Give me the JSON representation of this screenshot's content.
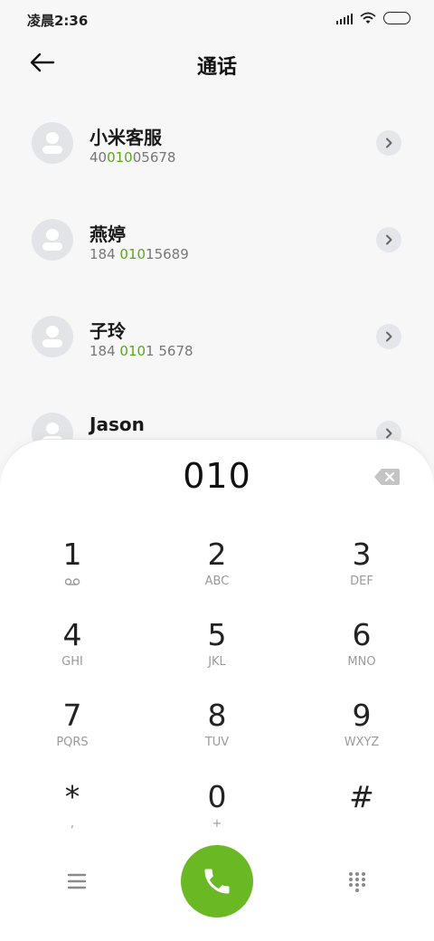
{
  "status_bar": {
    "time": "凌晨2:36",
    "icons": [
      "signal-icon",
      "wifi-icon",
      "battery-icon"
    ]
  },
  "header": {
    "title": "通话",
    "back_icon": "back-arrow-icon"
  },
  "contacts": [
    {
      "name": "小米客服",
      "number_parts": [
        "40",
        "010",
        "05678"
      ]
    },
    {
      "name": "燕婷",
      "number_parts": [
        "184 ",
        "010",
        "15689"
      ]
    },
    {
      "name": "子玲",
      "number_parts": [
        "184 ",
        "010",
        "1 5678"
      ]
    },
    {
      "name": "Jason",
      "number_parts": [
        "",
        "",
        ""
      ]
    }
  ],
  "dialer": {
    "input_value": "010",
    "keys": [
      {
        "digit": "1",
        "letters": "",
        "sub_icon": "voicemail-icon"
      },
      {
        "digit": "2",
        "letters": "ABC"
      },
      {
        "digit": "3",
        "letters": "DEF"
      },
      {
        "digit": "4",
        "letters": "GHI"
      },
      {
        "digit": "5",
        "letters": "JKL"
      },
      {
        "digit": "6",
        "letters": "MNO"
      },
      {
        "digit": "7",
        "letters": "PQRS"
      },
      {
        "digit": "8",
        "letters": "TUV"
      },
      {
        "digit": "9",
        "letters": "WXYZ"
      },
      {
        "digit": "*",
        "letters": ","
      },
      {
        "digit": "0",
        "letters": "+"
      },
      {
        "digit": "#",
        "letters": ""
      }
    ],
    "bottom_icons": [
      "menu-icon",
      "phone-icon",
      "dialpad-icon"
    ]
  },
  "colors": {
    "accent_green": "#6ab824",
    "highlight_green": "#5ca51d",
    "background": "#f7f7f7"
  }
}
